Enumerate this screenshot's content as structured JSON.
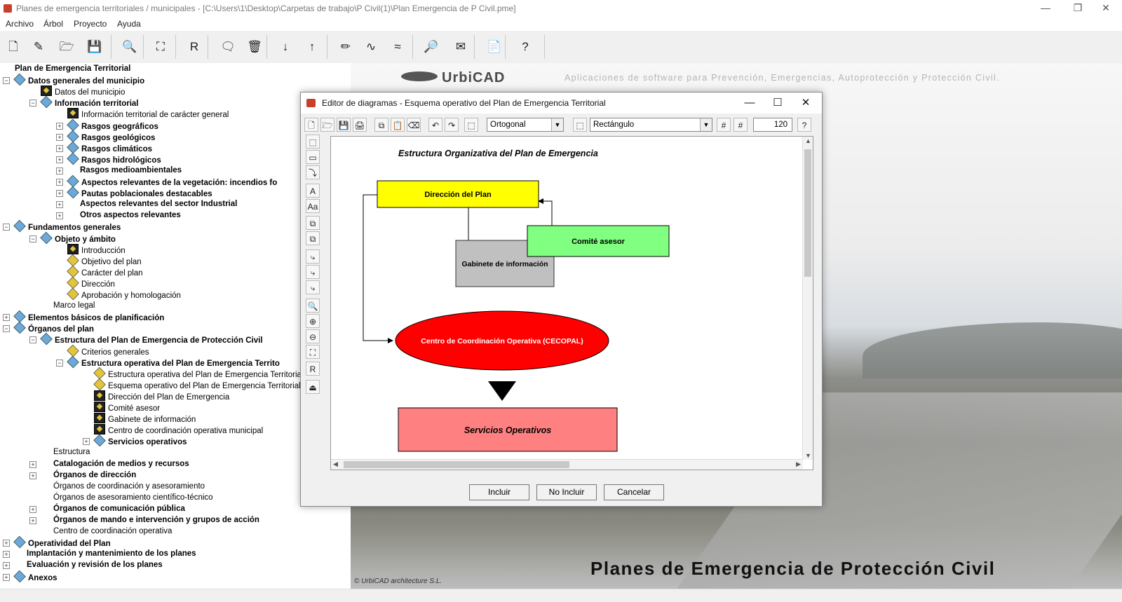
{
  "window": {
    "title": "Planes de emergencia territoriales / municipales - [C:\\Users\\1\\Desktop\\Carpetas de trabajo\\P Civil(1)\\Plan Emergencia de P Civil.pme]",
    "minimize": "—",
    "restore": "❐",
    "close": "✕"
  },
  "menu": [
    "Archivo",
    "Árbol",
    "Proyecto",
    "Ayuda"
  ],
  "toolbar_icons": [
    "new-file",
    "wand",
    "open-folder",
    "save",
    "preview",
    "binoculars",
    "report",
    "comment",
    "delete",
    "sort-desc",
    "sort-asc",
    "pencil",
    "waveform",
    "waves",
    "print-preview",
    "envelope",
    "pdf",
    "help"
  ],
  "toolbar_glyphs": [
    "🗋",
    "✎",
    "🗁",
    "💾",
    "🔍",
    "⛶",
    "R",
    "🗨",
    "🗑",
    "↓",
    "↑",
    "✏",
    "∿",
    "≈",
    "🔎",
    "✉",
    "📄",
    "?"
  ],
  "tree": [
    {
      "label": "Plan de Emergencia Territorial",
      "level": 0,
      "bold": true,
      "icon": "none",
      "exp": "none"
    },
    {
      "label": "Datos generales del municipio",
      "level": 1,
      "bold": true,
      "icon": "blue",
      "exp": "minus"
    },
    {
      "label": "Datos del municipio",
      "level": 2,
      "bold": false,
      "icon": "sq",
      "exp": "none"
    },
    {
      "label": "Información territorial",
      "level": 2,
      "bold": true,
      "icon": "blue",
      "exp": "minus"
    },
    {
      "label": "Información territorial de carácter general",
      "level": 3,
      "bold": false,
      "icon": "sq",
      "exp": "none"
    },
    {
      "label": "Rasgos geográficos",
      "level": 3,
      "bold": true,
      "icon": "blue",
      "exp": "plus"
    },
    {
      "label": "Rasgos geológicos",
      "level": 3,
      "bold": true,
      "icon": "blue",
      "exp": "plus"
    },
    {
      "label": "Rasgos climáticos",
      "level": 3,
      "bold": true,
      "icon": "blue",
      "exp": "plus"
    },
    {
      "label": "Rasgos hidrológicos",
      "level": 3,
      "bold": true,
      "icon": "blue",
      "exp": "plus"
    },
    {
      "label": "Rasgos medioambientales",
      "level": 3,
      "bold": true,
      "icon": "none",
      "exp": "plus"
    },
    {
      "label": "Aspectos relevantes de la vegetación: incendios fo",
      "level": 3,
      "bold": true,
      "icon": "blue",
      "exp": "plus"
    },
    {
      "label": "Pautas poblacionales destacables",
      "level": 3,
      "bold": true,
      "icon": "blue",
      "exp": "plus"
    },
    {
      "label": "Aspectos relevantes del sector Industrial",
      "level": 3,
      "bold": true,
      "icon": "none",
      "exp": "plus"
    },
    {
      "label": "Otros aspectos relevantes",
      "level": 3,
      "bold": true,
      "icon": "none",
      "exp": "plus"
    },
    {
      "label": "Fundamentos generales",
      "level": 1,
      "bold": true,
      "icon": "blue",
      "exp": "minus"
    },
    {
      "label": "Objeto y ámbito",
      "level": 2,
      "bold": true,
      "icon": "blue",
      "exp": "minus"
    },
    {
      "label": "Introducción",
      "level": 3,
      "bold": false,
      "icon": "sq",
      "exp": "none"
    },
    {
      "label": "Objetivo del plan",
      "level": 3,
      "bold": false,
      "icon": "dia",
      "exp": "none"
    },
    {
      "label": "Carácter del plan",
      "level": 3,
      "bold": false,
      "icon": "dia",
      "exp": "none"
    },
    {
      "label": "Dirección",
      "level": 3,
      "bold": false,
      "icon": "dia",
      "exp": "none"
    },
    {
      "label": "Aprobación y homologación",
      "level": 3,
      "bold": false,
      "icon": "dia",
      "exp": "none"
    },
    {
      "label": "Marco legal",
      "level": 2,
      "bold": false,
      "icon": "none",
      "exp": "none"
    },
    {
      "label": "Elementos básicos de planificación",
      "level": 1,
      "bold": true,
      "icon": "blue",
      "exp": "plus"
    },
    {
      "label": "Órganos del plan",
      "level": 1,
      "bold": true,
      "icon": "blue",
      "exp": "minus"
    },
    {
      "label": "Estructura del Plan de Emergencia de Protección Civil",
      "level": 2,
      "bold": true,
      "icon": "blue",
      "exp": "minus"
    },
    {
      "label": "Criterios generales",
      "level": 3,
      "bold": false,
      "icon": "dia",
      "exp": "none"
    },
    {
      "label": "Estructura operativa del Plan de Emergencia Territo",
      "level": 3,
      "bold": true,
      "icon": "blue",
      "exp": "minus"
    },
    {
      "label": "Estructura operativa del Plan de Emergencia Territorial",
      "level": 4,
      "bold": false,
      "icon": "dia",
      "exp": "none"
    },
    {
      "label": "Esquema operativo del Plan de Emergencia Territorial",
      "level": 4,
      "bold": false,
      "icon": "dia",
      "exp": "none"
    },
    {
      "label": "Dirección del Plan de Emergencia",
      "level": 4,
      "bold": false,
      "icon": "sq",
      "exp": "none"
    },
    {
      "label": "Comité asesor",
      "level": 4,
      "bold": false,
      "icon": "sq",
      "exp": "none"
    },
    {
      "label": "Gabinete de información",
      "level": 4,
      "bold": false,
      "icon": "sq",
      "exp": "none"
    },
    {
      "label": "Centro de coordinación operativa municipal",
      "level": 4,
      "bold": false,
      "icon": "sq",
      "exp": "none"
    },
    {
      "label": "Servicios operativos",
      "level": 4,
      "bold": true,
      "icon": "blue",
      "exp": "plus"
    },
    {
      "label": "Estructura",
      "level": 2,
      "bold": false,
      "icon": "none",
      "exp": "none"
    },
    {
      "label": "Catalogación de medios y recursos",
      "level": 2,
      "bold": true,
      "icon": "none",
      "exp": "plus"
    },
    {
      "label": "Órganos de dirección",
      "level": 2,
      "bold": true,
      "icon": "none",
      "exp": "plus"
    },
    {
      "label": "Órganos de coordinación y asesoramiento",
      "level": 2,
      "bold": false,
      "icon": "none",
      "exp": "none"
    },
    {
      "label": "Órganos de asesoramiento científico-técnico",
      "level": 2,
      "bold": false,
      "icon": "none",
      "exp": "none"
    },
    {
      "label": "Órganos de comunicación pública",
      "level": 2,
      "bold": true,
      "icon": "none",
      "exp": "plus"
    },
    {
      "label": "Órganos de mando e intervención y grupos de acción",
      "level": 2,
      "bold": true,
      "icon": "none",
      "exp": "plus"
    },
    {
      "label": "Centro de coordinación operativa",
      "level": 2,
      "bold": false,
      "icon": "none",
      "exp": "none"
    },
    {
      "label": "Operatividad del Plan",
      "level": 1,
      "bold": true,
      "icon": "blue",
      "exp": "plus"
    },
    {
      "label": "Implantación y mantenimiento de los planes",
      "level": 1,
      "bold": true,
      "icon": "none",
      "exp": "plus"
    },
    {
      "label": "Evaluación y revisión de los planes",
      "level": 1,
      "bold": true,
      "icon": "none",
      "exp": "plus"
    },
    {
      "label": "Anexos",
      "level": 1,
      "bold": true,
      "icon": "blue",
      "exp": "plus"
    }
  ],
  "branding": {
    "logo": "UrbiCAD",
    "tagline": "Aplicaciones de software para Prevención, Emergencias, Autoprotección y Protección Civil.",
    "big_title": "Planes de Emergencia de Protección Civil",
    "copyright": "© UrbiCAD architecture S.L."
  },
  "dialog": {
    "title": "Editor de diagramas - Esquema operativo del Plan de Emergencia Territorial",
    "line_style": "Ortogonal",
    "shape": "Rectángulo",
    "zoom": "120",
    "buttons": {
      "include": "Incluir",
      "not_include": "No Incluir",
      "cancel": "Cancelar"
    },
    "toolbar_glyphs": [
      "🗋",
      "🗁",
      "💾",
      "🖨",
      "⧉",
      "📋",
      "⌫",
      "↶",
      "↷",
      "⬚"
    ],
    "side_glyphs": [
      "⬚",
      "▭",
      "⤵",
      "A",
      "Aa",
      "⧉",
      "⧉",
      "⤷",
      "⤷",
      "⤷",
      "🔍",
      "⊕",
      "⊖",
      "⛶",
      "R",
      "⏏"
    ],
    "diagram": {
      "title": "Estructura Organizativa del Plan de Emergencia",
      "direccion": "Dirección del Plan",
      "comite": "Comité asesor",
      "gabinete": "Gabinete de información",
      "cecopal": "Centro de Coordinación Operativa (CECOPAL)",
      "servicios": "Servicios Operativos",
      "colors": {
        "direccion": "#ffff00",
        "comite": "#80ff80",
        "gabinete": "#c0c0c0",
        "cecopal": "#ff0000",
        "servicios": "#ff8080"
      }
    }
  }
}
